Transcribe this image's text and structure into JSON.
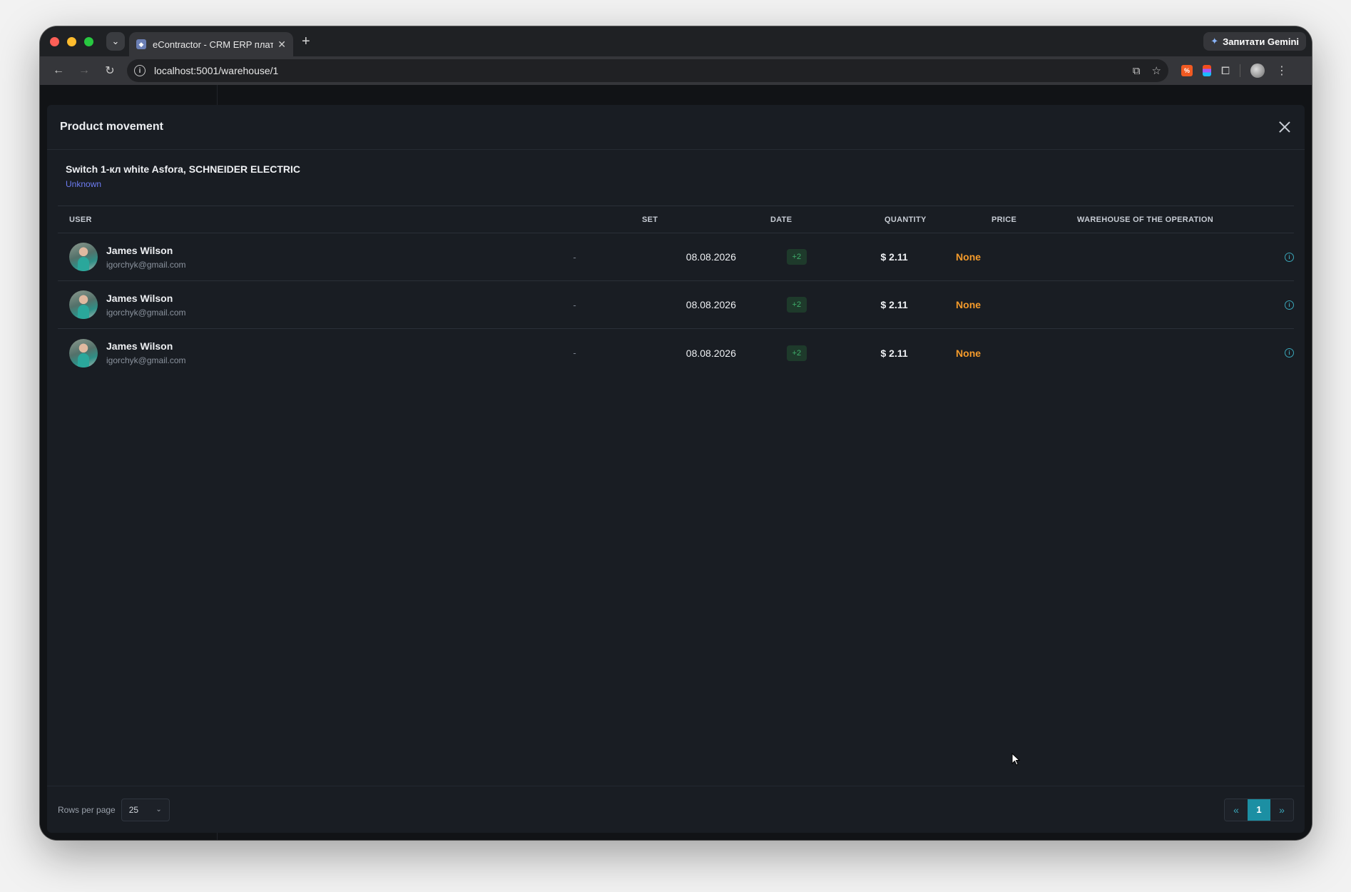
{
  "browser": {
    "tab_title": "eContractor - CRM ERP плат",
    "url": "localhost:5001/warehouse/1",
    "gemini_label": "Запитати Gemini"
  },
  "modal": {
    "title": "Product movement",
    "product": {
      "name": "Switch 1-кл white Asfora, SCHNEIDER ELECTRIC",
      "status": "Unknown"
    },
    "table": {
      "headers": {
        "user": "USER",
        "set": "SET",
        "date": "DATE",
        "quantity": "QUANTITY",
        "price": "PRICE",
        "warehouse": "WAREHOUSE OF THE OPERATION"
      },
      "rows": [
        {
          "name": "James Wilson",
          "email": "igorchyk@gmail.com",
          "set": "-",
          "date": "08.08.2026",
          "quantity": "+2",
          "price": "$ 2.11",
          "warehouse": "None"
        },
        {
          "name": "James Wilson",
          "email": "igorchyk@gmail.com",
          "set": "-",
          "date": "08.08.2026",
          "quantity": "+2",
          "price": "$ 2.11",
          "warehouse": "None"
        },
        {
          "name": "James Wilson",
          "email": "igorchyk@gmail.com",
          "set": "-",
          "date": "08.08.2026",
          "quantity": "+2",
          "price": "$ 2.11",
          "warehouse": "None"
        }
      ]
    },
    "footer": {
      "rows_per_page_label": "Rows per page",
      "rows_per_page_value": "25",
      "pagination": {
        "prev": "«",
        "current": "1",
        "next": "»"
      }
    }
  }
}
